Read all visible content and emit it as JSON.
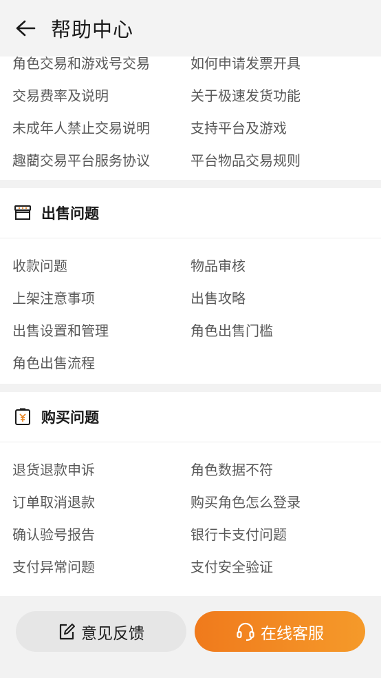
{
  "header": {
    "title": "帮助中心"
  },
  "intro_section": {
    "links": [
      "角色交易和游戏号交易",
      "如何申请发票开具",
      "交易费率及说明",
      "关于极速发货功能",
      "未成年人禁止交易说明",
      "支持平台及游戏",
      "趣藺交易平台服务协议",
      "平台物品交易规则"
    ]
  },
  "sell_section": {
    "title": "出售问题",
    "icon": "store-icon",
    "links": [
      "收款问题",
      "物品审核",
      "上架注意事项",
      "出售攻略",
      "出售设置和管理",
      "角色出售门槛",
      "角色出售流程"
    ]
  },
  "buy_section": {
    "title": "购买问题",
    "icon": "yuan-receipt-icon",
    "links": [
      "退货退款申诉",
      "角色数据不符",
      "订单取消退款",
      "购买角色怎么登录",
      "确认验号报告",
      "银行卡支付问题",
      "支付异常问题",
      "支付安全验证"
    ]
  },
  "bottom": {
    "feedback_label": "意见反馈",
    "service_label": "在线客服",
    "accent_color": "#f07a1c"
  }
}
